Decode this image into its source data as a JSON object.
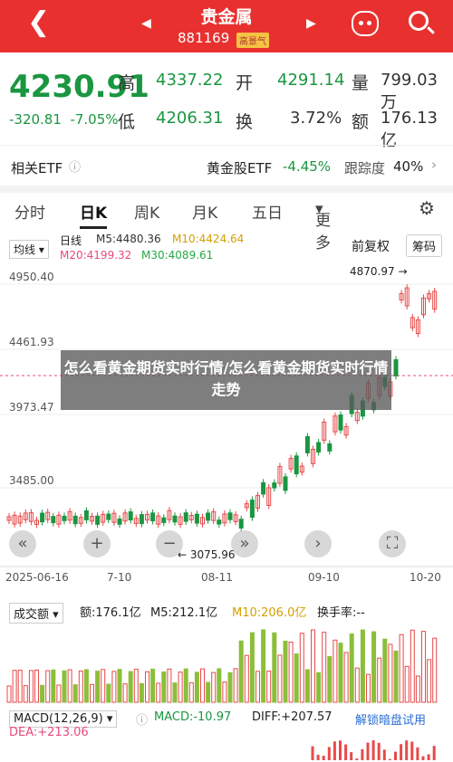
{
  "header": {
    "title": "贵金属",
    "code": "881169",
    "tag": "高景气"
  },
  "quote": {
    "price": "4230.91",
    "change": "-320.81",
    "change_pct": "-7.05%",
    "high_label": "高",
    "high": "4337.22",
    "open_label": "开",
    "open": "4291.14",
    "volume_label": "量",
    "volume": "799.03万",
    "low_label": "低",
    "low": "4206.31",
    "turnover_label": "换",
    "turnover": "3.72%",
    "amount_label": "额",
    "amount": "176.13亿"
  },
  "etf": {
    "label": "相关ETF",
    "gold_label": "黄金股ETF",
    "gold_change": "-4.45%",
    "tracking_label": "跟踪度",
    "tracking": "40%"
  },
  "tabs": [
    "分时",
    "日K",
    "周K",
    "月K",
    "五日",
    "更多"
  ],
  "chart": {
    "ma_select": "均线",
    "period": "日线",
    "ma5": "M5:4480.36",
    "ma10": "M10:4424.64",
    "ma20": "M20:4199.32",
    "ma30": "M30:4089.61",
    "adjust_label": "前复权",
    "chip_button": "筹码",
    "y_labels": [
      "4950.40",
      "4461.93",
      "3973.47",
      "3485.00"
    ],
    "x_labels": [
      "2025-06-16",
      "7-10",
      "08-11",
      "09-10",
      "10-20"
    ],
    "max_marker": "4870.97",
    "min_marker": "3075.96"
  },
  "overlay_text": "怎么看黄金期货实时行情/怎么看黄金期货实时行情走势",
  "volume": {
    "select": "成交额",
    "amount": "额:176.1亿",
    "m5": "M5:212.1亿",
    "m10": "M10:206.0亿",
    "turnover": "换手率:--"
  },
  "macd": {
    "select": "MACD(12,26,9)",
    "macd": "MACD:-10.97",
    "diff": "DIFF:+207.57",
    "dea": "DEA:+213.06",
    "trial": "解锁暗盘试用"
  }
}
